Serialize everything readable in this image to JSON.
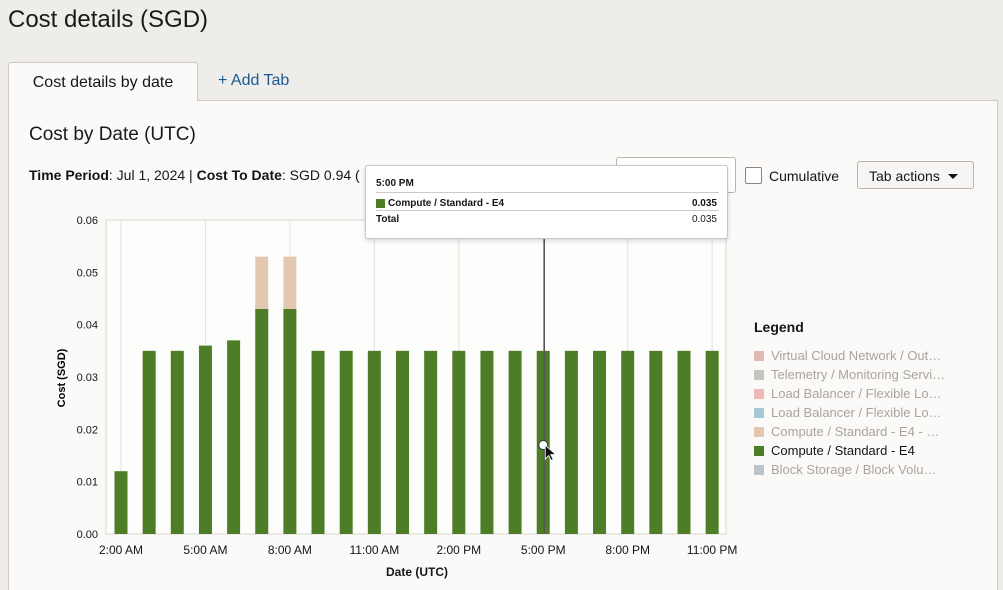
{
  "page": {
    "title": "Cost details (SGD)"
  },
  "tabs": [
    {
      "label": "Cost details by date",
      "active": true
    },
    {
      "label": "+ Add Tab",
      "active": false
    }
  ],
  "section": {
    "title": "Cost by Date (UTC)"
  },
  "summary": {
    "time_period_label": "Time Period",
    "time_period_value": ": Jul 1, 2024 | ",
    "cost_to_date_label": "Cost To Date",
    "cost_to_date_value": ": SGD 0.94 ("
  },
  "controls": {
    "cumulative_label": "Cumulative",
    "cumulative_checked": false,
    "tab_actions_label": "Tab actions"
  },
  "tooltip": {
    "time": "5:00 PM",
    "series_name": "Compute / Standard - E4",
    "series_value": "0.035",
    "total_label": "Total",
    "total_value": "0.035",
    "swatch_color": "#4e7d27"
  },
  "legend": {
    "title": "Legend",
    "items": [
      {
        "label": "Virtual Cloud Network / Out…",
        "color": "#e2b8b5",
        "active": false
      },
      {
        "label": "Telemetry / Monitoring Servi…",
        "color": "#c6c4c1",
        "active": false
      },
      {
        "label": "Load Balancer / Flexible Lo…",
        "color": "#ecb9b6",
        "active": false
      },
      {
        "label": "Load Balancer / Flexible Lo…",
        "color": "#a6c8d6",
        "active": false
      },
      {
        "label": "Compute / Standard - E4 - …",
        "color": "#e3c8b1",
        "active": false
      },
      {
        "label": "Compute / Standard - E4",
        "color": "#4e7d27",
        "active": true
      },
      {
        "label": "Block Storage / Block Volu…",
        "color": "#b9c4cc",
        "active": false
      }
    ]
  },
  "chart_data": {
    "type": "bar",
    "stacked": true,
    "xlabel": "Date (UTC)",
    "ylabel": "Cost (SGD)",
    "ylim": [
      0,
      0.06
    ],
    "yticks": [
      "0.00",
      "0.01",
      "0.02",
      "0.03",
      "0.04",
      "0.05",
      "0.06"
    ],
    "grid": true,
    "legend_position": "right",
    "categories": [
      "2:00 AM",
      "3:00 AM",
      "4:00 AM",
      "5:00 AM",
      "6:00 AM",
      "7:00 AM",
      "8:00 AM",
      "9:00 AM",
      "10:00 AM",
      "11:00 AM",
      "12:00 PM",
      "1:00 PM",
      "2:00 PM",
      "3:00 PM",
      "4:00 PM",
      "5:00 PM",
      "6:00 PM",
      "7:00 PM",
      "8:00 PM",
      "9:00 PM",
      "10:00 PM",
      "11:00 PM"
    ],
    "xtick_labels": [
      "2:00 AM",
      "5:00 AM",
      "8:00 AM",
      "11:00 AM",
      "2:00 PM",
      "5:00 PM",
      "8:00 PM",
      "11:00 PM"
    ],
    "series": [
      {
        "name": "Compute / Standard - E4",
        "color": "#4e7d27",
        "values": [
          0.012,
          0.035,
          0.035,
          0.036,
          0.037,
          0.043,
          0.043,
          0.035,
          0.035,
          0.035,
          0.035,
          0.035,
          0.035,
          0.035,
          0.035,
          0.035,
          0.035,
          0.035,
          0.035,
          0.035,
          0.035,
          0.035
        ]
      },
      {
        "name": "Compute / Standard - E4 - …",
        "color": "#e3c8b1",
        "values": [
          0,
          0,
          0,
          0,
          0,
          0.01,
          0.01,
          0,
          0,
          0,
          0,
          0,
          0,
          0,
          0,
          0,
          0,
          0,
          0,
          0,
          0,
          0
        ]
      }
    ],
    "crosshair_category": "5:00 PM"
  }
}
